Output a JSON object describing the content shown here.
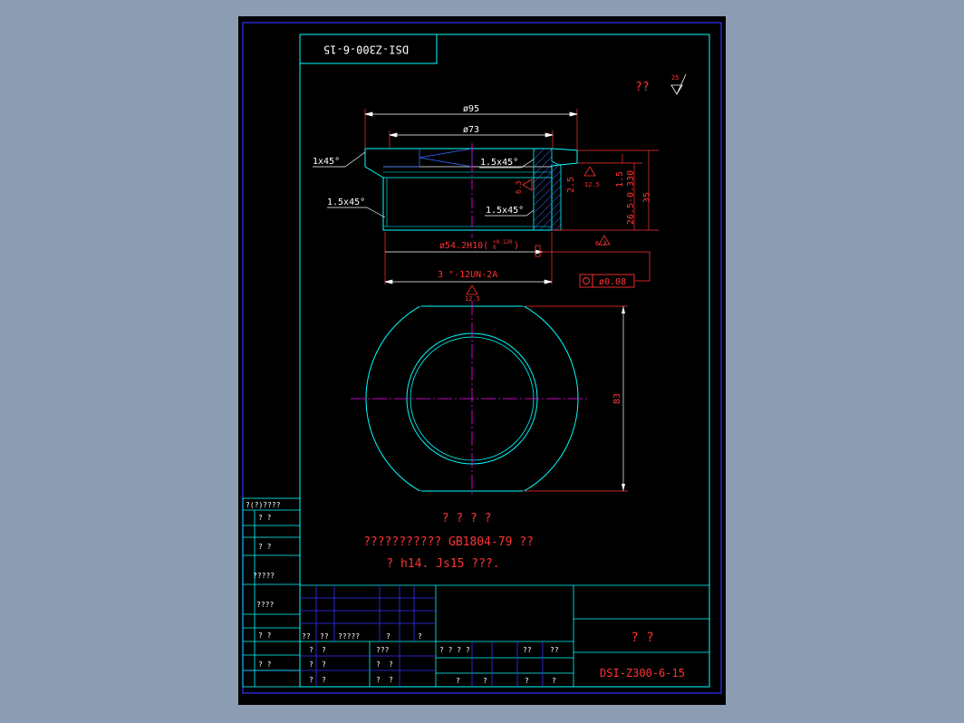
{
  "drawing": {
    "drawing_no_rotated": "DSI-Z300-6-15",
    "roughness_symbol_text": "??",
    "roughness_value": "25",
    "dims": {
      "d95": "ø95",
      "d73": "ø73",
      "chamfer_left_top": "1x45°",
      "chamfer_mid": "1.5x45°",
      "chamfer_left_bottom": "1.5x45°",
      "chamfer_inner_bottom": "1.5x45°",
      "bore": "ø54.2H10(",
      "bore_tol_upper": "+0.120",
      "bore_tol_lower": "0",
      "thread": "3 \"-12UN-2A",
      "h35": "35",
      "h265": "26.5-0.330",
      "h15": "1.5",
      "h25": "2.5",
      "r125a": "12.5",
      "r63a": "6.3",
      "r63b": "6.3",
      "r125b": "12.5",
      "width83": "83",
      "tolerance_frame": "ø0.08"
    },
    "notes": {
      "heading": "? ? ? ?",
      "line1": "??????????? GB1804-79 ??",
      "line2": "? h14. Js15 ???."
    }
  },
  "side_block": {
    "rows": [
      "?(?)????",
      "?   ?",
      "?   ?",
      "?????",
      "????",
      "?   ?",
      "?   ?"
    ]
  },
  "title_block": {
    "left_labels": [
      "??",
      "??",
      "?????",
      "?",
      "?"
    ],
    "left_rows": [
      [
        "?",
        "?",
        "???"
      ],
      [
        "?",
        "?",
        "?",
        "?"
      ],
      [
        "?",
        "?",
        "?",
        "?"
      ]
    ],
    "mid_row1": [
      "? ? ? ?",
      "??",
      "??"
    ],
    "mid_row2": [
      "?",
      "?",
      "?",
      "?"
    ],
    "name": "?   ?",
    "drawing_no": "DSI-Z300-6-15"
  }
}
